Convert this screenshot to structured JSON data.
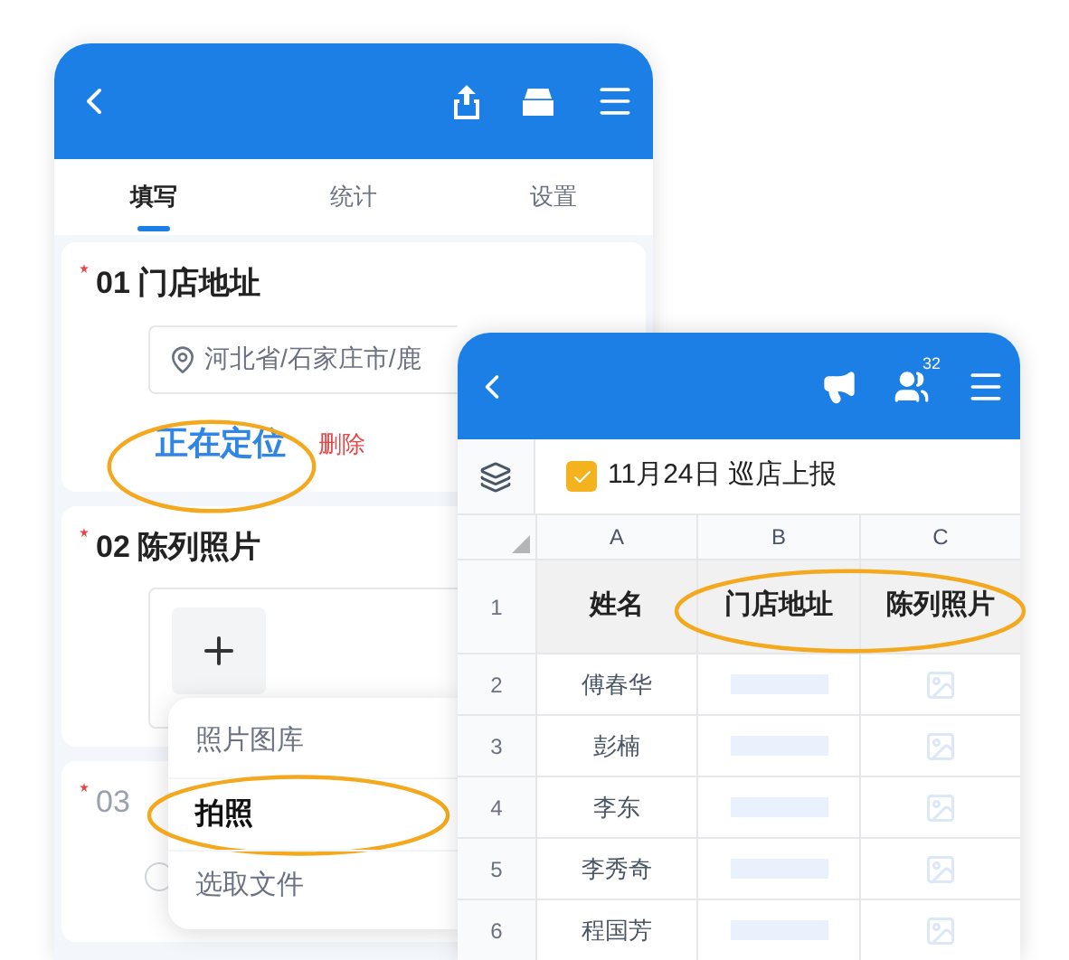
{
  "form_screen": {
    "tabs": [
      {
        "label": "填写",
        "selected": true
      },
      {
        "label": "统计",
        "selected": false
      },
      {
        "label": "设置",
        "selected": false
      }
    ],
    "questions": [
      {
        "kind": "address",
        "number": "01",
        "required": true,
        "title": "门店地址",
        "value": "河北省/石家庄市/鹿",
        "status": "正在定位",
        "status_highlighted": true,
        "delete": "删除"
      },
      {
        "kind": "photo",
        "number": "02",
        "required": true,
        "title": "陈列照片"
      },
      {
        "kind": "choice",
        "number": "03",
        "required": true,
        "options": [
          {
            "selected": false
          }
        ]
      }
    ],
    "photo_menu": [
      {
        "label": "照片图库",
        "selected": false
      },
      {
        "label": "拍照",
        "selected": true
      },
      {
        "label": "选取文件",
        "selected": false
      }
    ]
  },
  "sheet_screen": {
    "member_count": "32",
    "title": "11月24日 巡店上报",
    "title_checked": true,
    "columns": [
      "A",
      "B",
      "C"
    ],
    "rows": [
      {
        "kind": "header",
        "number": "1",
        "cells": [
          "姓名",
          "门店地址",
          "陈列照片"
        ],
        "highlighted": true
      },
      {
        "kind": "data",
        "number": "2",
        "cells": [
          "傅春华"
        ]
      },
      {
        "kind": "data",
        "number": "3",
        "cells": [
          "彭楠"
        ]
      },
      {
        "kind": "data",
        "number": "4",
        "cells": [
          "李东"
        ]
      },
      {
        "kind": "data",
        "number": "5",
        "cells": [
          "李秀奇"
        ]
      },
      {
        "kind": "data",
        "number": "6",
        "cells": [
          "程国芳"
        ]
      }
    ]
  }
}
